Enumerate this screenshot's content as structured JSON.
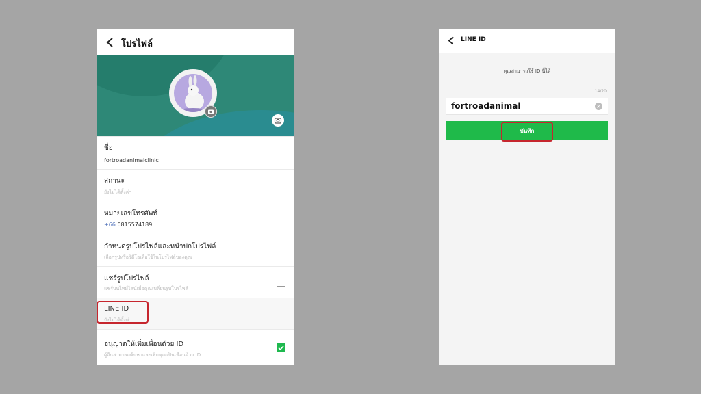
{
  "left": {
    "title": "โปรไฟล์",
    "rows": {
      "name": {
        "label": "ชื่อ",
        "value": "fortroadanimalclinic"
      },
      "status": {
        "label": "สถานะ",
        "sub": "ยังไม่ได้ตั้งค่า"
      },
      "phone": {
        "label": "หมายเลขโทรศัพท์",
        "code": "+66",
        "number": "0815574189"
      },
      "photo": {
        "label": "กำหนดรูปโปรไฟล์และหน้าปกโปรไฟล์",
        "sub": "เลือกรูปหรือวิดีโอเพื่อใช้ในโปรไฟล์ของคุณ"
      },
      "share": {
        "label": "แชร์รูปโปรไฟล์",
        "sub": "แชร์บนไทม์ไลน์เมื่อคุณเปลี่ยนรูปโปรไฟล์",
        "checked": false
      },
      "lineid": {
        "label": "LINE ID",
        "sub": "ยังไม่ได้ตั้งค่า"
      },
      "allow": {
        "label": "อนุญาตให้เพิ่มเพื่อนด้วย ID",
        "sub": "ผู้อื่นสามารถค้นหาและเพิ่มคุณเป็นเพื่อนด้วย ID",
        "checked": true
      }
    }
  },
  "right": {
    "title": "LINE ID",
    "hint": "คุณสามารถใช้ ID นี้ได้",
    "counter": "14/20",
    "id_value": "fortroadanimal",
    "save_label": "บันทึก"
  },
  "colors": {
    "background": "#a5a5a5",
    "cover": "#2e8877",
    "accent_green": "#1fba4a",
    "highlight_red": "#c6262e"
  }
}
